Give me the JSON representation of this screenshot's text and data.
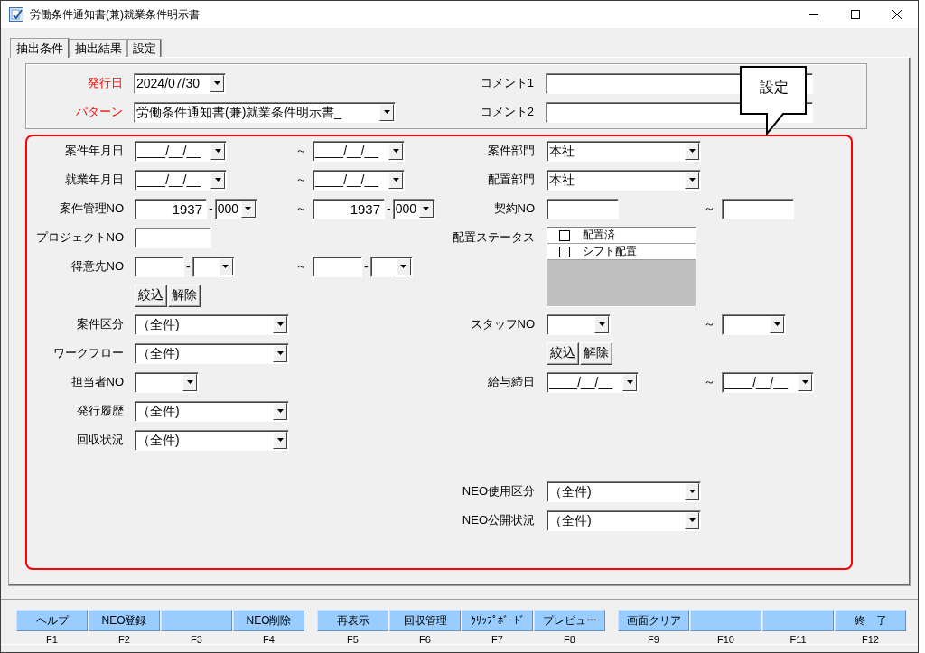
{
  "window": {
    "title": "労働条件通知書(兼)就業条件明示書"
  },
  "tabs": [
    {
      "label": "抽出条件",
      "selected": true
    },
    {
      "label": "抽出結果",
      "selected": false
    },
    {
      "label": "設定",
      "selected": false
    }
  ],
  "header": {
    "left": [
      {
        "label": "発行日",
        "required": true,
        "control": {
          "kind": "date",
          "value": "2024/07/30"
        }
      },
      {
        "label": "パターン",
        "required": true,
        "control": {
          "kind": "pattern",
          "value": "労働条件通知書(兼)就業条件明示書_"
        }
      }
    ],
    "right": [
      {
        "label": "コメント1",
        "required": false,
        "control": {
          "kind": "comment"
        }
      },
      {
        "label": "コメント2",
        "required": false,
        "control": {
          "kind": "comment"
        }
      }
    ]
  },
  "callout": {
    "text": "設定"
  },
  "conditions": {
    "left": [
      {
        "label": "案件年月日",
        "required": false,
        "from": [
          {
            "kind": "date",
            "value": "____/__/__"
          }
        ],
        "separator": "～",
        "to": [
          {
            "kind": "date",
            "value": "____/__/__"
          }
        ]
      },
      {
        "label": "就業年月日",
        "required": false,
        "from": [
          {
            "kind": "date",
            "value": "____/__/__"
          }
        ],
        "separator": "～",
        "to": [
          {
            "kind": "date",
            "value": "____/__/__"
          }
        ]
      },
      {
        "label": "案件管理NO",
        "required": false,
        "from": [
          {
            "kind": "number",
            "value": "1937"
          },
          {
            "kind": "dash",
            "text": "-"
          },
          {
            "kind": "mini-combo",
            "value": "000"
          }
        ],
        "separator": "～",
        "to": [
          {
            "kind": "number",
            "value": "1937"
          },
          {
            "kind": "dash",
            "text": "-"
          },
          {
            "kind": "mini-combo",
            "value": "000"
          }
        ]
      },
      {
        "label": "プロジェクトNO",
        "required": false,
        "from": [
          {
            "kind": "field"
          }
        ]
      },
      {
        "label": "得意先NO",
        "required": false,
        "from": [
          {
            "kind": "code-field"
          },
          {
            "kind": "dash",
            "text": "-"
          },
          {
            "kind": "mini-combo"
          }
        ],
        "separator": "～",
        "to": [
          {
            "kind": "code-field"
          },
          {
            "kind": "dash",
            "text": "-"
          },
          {
            "kind": "mini-combo"
          }
        ]
      },
      {
        "from": [
          {
            "kind": "button",
            "label": "絞込"
          },
          {
            "kind": "button",
            "label": "解除"
          }
        ]
      },
      {
        "label": "案件区分",
        "required": false,
        "from": [
          {
            "kind": "select",
            "value": "（全件)"
          }
        ]
      },
      {
        "label": "ワークフロー",
        "required": false,
        "from": [
          {
            "kind": "select",
            "value": "（全件)"
          }
        ]
      },
      {
        "label": "担当者NO",
        "required": false,
        "from": [
          {
            "kind": "small-combo"
          }
        ]
      },
      {
        "label": "発行履歴",
        "required": false,
        "from": [
          {
            "kind": "select",
            "value": "（全件)"
          }
        ]
      },
      {
        "label": "回収状況",
        "required": false,
        "from": [
          {
            "kind": "select",
            "value": "（全件)"
          }
        ]
      }
    ],
    "right": [
      {
        "label": "案件部門",
        "required": false,
        "from": [
          {
            "kind": "select",
            "value": "本社"
          }
        ]
      },
      {
        "label": "配置部門",
        "required": false,
        "from": [
          {
            "kind": "select",
            "value": "本社"
          }
        ]
      },
      {
        "label": "契約NO",
        "required": false,
        "from": [
          {
            "kind": "contract-field"
          }
        ],
        "separator": "～",
        "to": [
          {
            "kind": "contract-field"
          }
        ]
      },
      {
        "label": "配置ステータス",
        "required": false,
        "from": [
          {
            "kind": "checklist",
            "items": [
              {
                "label": "配置済",
                "checked": false
              },
              {
                "label": "シフト配置",
                "checked": false
              }
            ]
          }
        ]
      },
      {
        "label": "スタッフNO",
        "required": false,
        "from": [
          {
            "kind": "small-combo"
          }
        ],
        "separator": "～",
        "to": [
          {
            "kind": "small-combo"
          }
        ]
      },
      {
        "from": [
          {
            "kind": "button",
            "label": "絞込"
          },
          {
            "kind": "button",
            "label": "解除"
          }
        ]
      },
      {
        "label": "給与締日",
        "required": false,
        "from": [
          {
            "kind": "date",
            "value": "____/__/__"
          }
        ],
        "separator": "～",
        "to": [
          {
            "kind": "date",
            "value": "____/__/__"
          }
        ]
      }
    ],
    "right_lower": [
      {
        "label": "NEO使用区分",
        "required": false,
        "from": [
          {
            "kind": "select",
            "value": "（全件)"
          }
        ]
      },
      {
        "label": "NEO公開状況",
        "required": false,
        "from": [
          {
            "kind": "select",
            "value": "（全件)"
          }
        ]
      }
    ]
  },
  "function_keys": [
    {
      "label": "ヘルプ",
      "key": "F1"
    },
    {
      "label": "NEO登録",
      "key": "F2"
    },
    {
      "key": "F3"
    },
    {
      "label": "NEO削除",
      "key": "F4"
    },
    {
      "label": "再表示",
      "key": "F5"
    },
    {
      "label": "回収管理",
      "key": "F6"
    },
    {
      "label": "ｸﾘｯﾌﾟﾎﾞｰﾄﾞ",
      "key": "F7"
    },
    {
      "label": "プレビュー",
      "key": "F8"
    },
    {
      "label": "画面クリア",
      "key": "F9"
    },
    {
      "key": "F10"
    },
    {
      "key": "F11"
    },
    {
      "label": "終　了",
      "key": "F12"
    }
  ]
}
